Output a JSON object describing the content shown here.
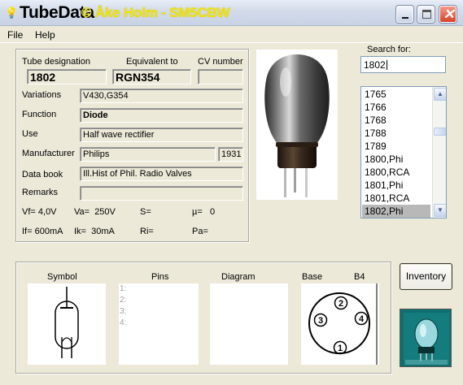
{
  "window": {
    "title": "TubeData",
    "subtitle": "© Åke Holm - SM5CBW",
    "app_icon": "lamp-icon"
  },
  "menu": [
    "File",
    "Help"
  ],
  "tube": {
    "labels": {
      "designation": "Tube designation",
      "equivalent": "Equivalent to",
      "cv": "CV number",
      "variations": "Variations",
      "function": "Function",
      "use": "Use",
      "manufacturer": "Manufacturer",
      "data_book": "Data book",
      "remarks": "Remarks"
    },
    "designation": "1802",
    "equivalent": "RGN354",
    "cv": "",
    "variations": "V430,G354",
    "function": "Diode",
    "use": "Half wave rectifier",
    "manufacturer": "Philips",
    "year": "1931",
    "data_book": "Ill.Hist of Phil. Radio Valves",
    "remarks": "",
    "params_row1": [
      {
        "label": "Vf=",
        "value": "4,0V"
      },
      {
        "label": "Va=",
        "value": "250V"
      },
      {
        "label": "S=",
        "value": ""
      },
      {
        "label": "µ=",
        "value": "0"
      }
    ],
    "params_row2": [
      {
        "label": "If=",
        "value": "600mA"
      },
      {
        "label": "Ik=",
        "value": "30mA"
      },
      {
        "label": "Ri=",
        "value": ""
      },
      {
        "label": "Pa=",
        "value": ""
      }
    ]
  },
  "search": {
    "label": "Search for:",
    "value": "1802"
  },
  "list": {
    "items": [
      "1765",
      "1766",
      "1768",
      "1788",
      "1789",
      "1800,Phi",
      "1800,RCA",
      "1801,Phi",
      "1801,RCA",
      "1802,Phi"
    ],
    "selected": "1802,Phi"
  },
  "bottom": {
    "symbol_label": "Symbol",
    "pins_label": "Pins",
    "diagram_label": "Diagram",
    "base_label": "Base",
    "base_type": "B4",
    "pins": [
      "1:",
      "2:",
      "3:",
      "4:"
    ],
    "base_pin_numbers": [
      "1",
      "2",
      "3",
      "4"
    ],
    "inventory_label": "Inventory"
  }
}
